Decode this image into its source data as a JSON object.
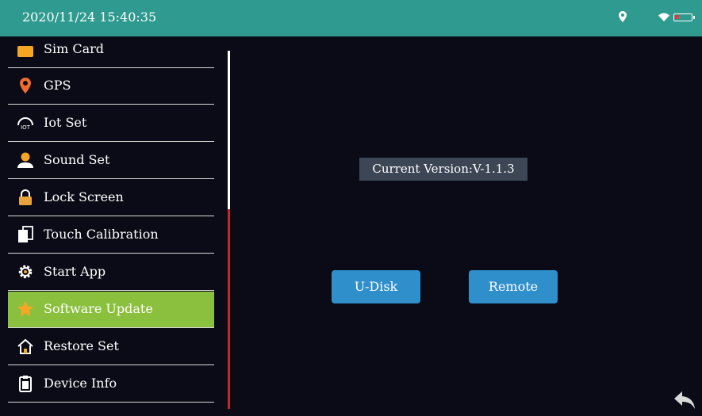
{
  "status_bar": {
    "datetime": "2020/11/24 15:40:35",
    "icons": [
      "location-icon",
      "wifi-icon",
      "battery-icon"
    ],
    "battery_color": "#e53935"
  },
  "sidebar": {
    "items": [
      {
        "label": "Sim Card",
        "icon": "sim-card-icon"
      },
      {
        "label": "GPS",
        "icon": "location-pin-icon"
      },
      {
        "label": "Iot Set",
        "icon": "iot-icon"
      },
      {
        "label": "Sound Set",
        "icon": "user-icon"
      },
      {
        "label": "Lock Screen",
        "icon": "lock-icon"
      },
      {
        "label": "Touch Calibration",
        "icon": "copy-icon"
      },
      {
        "label": "Start App",
        "icon": "gear-icon"
      },
      {
        "label": "Software Update",
        "icon": "star-icon",
        "active": true
      },
      {
        "label": "Restore Set",
        "icon": "home-icon"
      },
      {
        "label": "Device Info",
        "icon": "clipboard-icon"
      }
    ],
    "active_color": "#8bc03f"
  },
  "main": {
    "version_text": "Current Version:V-1.1.3",
    "udisk_label": "U-Disk",
    "remote_label": "Remote",
    "button_color": "#2f8fcb"
  },
  "back_icon": "back-arrow-icon"
}
